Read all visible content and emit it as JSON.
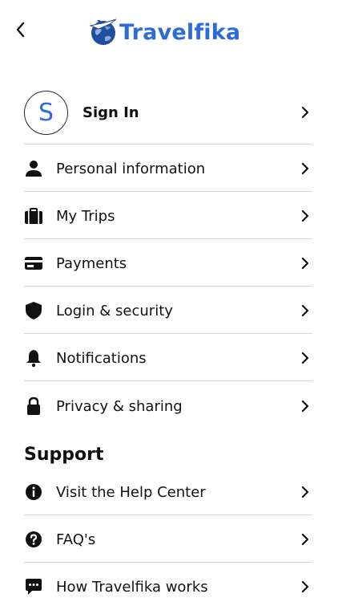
{
  "header": {
    "brand_name": "Travelfika",
    "back_icon": "chevron-left-icon",
    "logo_icon": "globe-plane-logo"
  },
  "account": {
    "avatar_initial": "S",
    "sign_in_label": "Sign In"
  },
  "menu": {
    "items": [
      {
        "label": "Personal information",
        "icon": "person-icon"
      },
      {
        "label": "My Trips",
        "icon": "suitcase-icon"
      },
      {
        "label": "Payments",
        "icon": "credit-card-icon"
      },
      {
        "label": "Login & security",
        "icon": "shield-icon"
      },
      {
        "label": "Notifications",
        "icon": "bell-icon"
      },
      {
        "label": "Privacy & sharing",
        "icon": "lock-icon"
      }
    ]
  },
  "support": {
    "title": "Support",
    "items": [
      {
        "label": "Visit the Help Center",
        "icon": "info-icon"
      },
      {
        "label": "FAQ's",
        "icon": "question-icon"
      },
      {
        "label": "How Travelfika works",
        "icon": "chat-icon"
      }
    ]
  },
  "colors": {
    "brand": "#2f6bd6",
    "text": "#111111",
    "divider": "#d6d6d6"
  }
}
